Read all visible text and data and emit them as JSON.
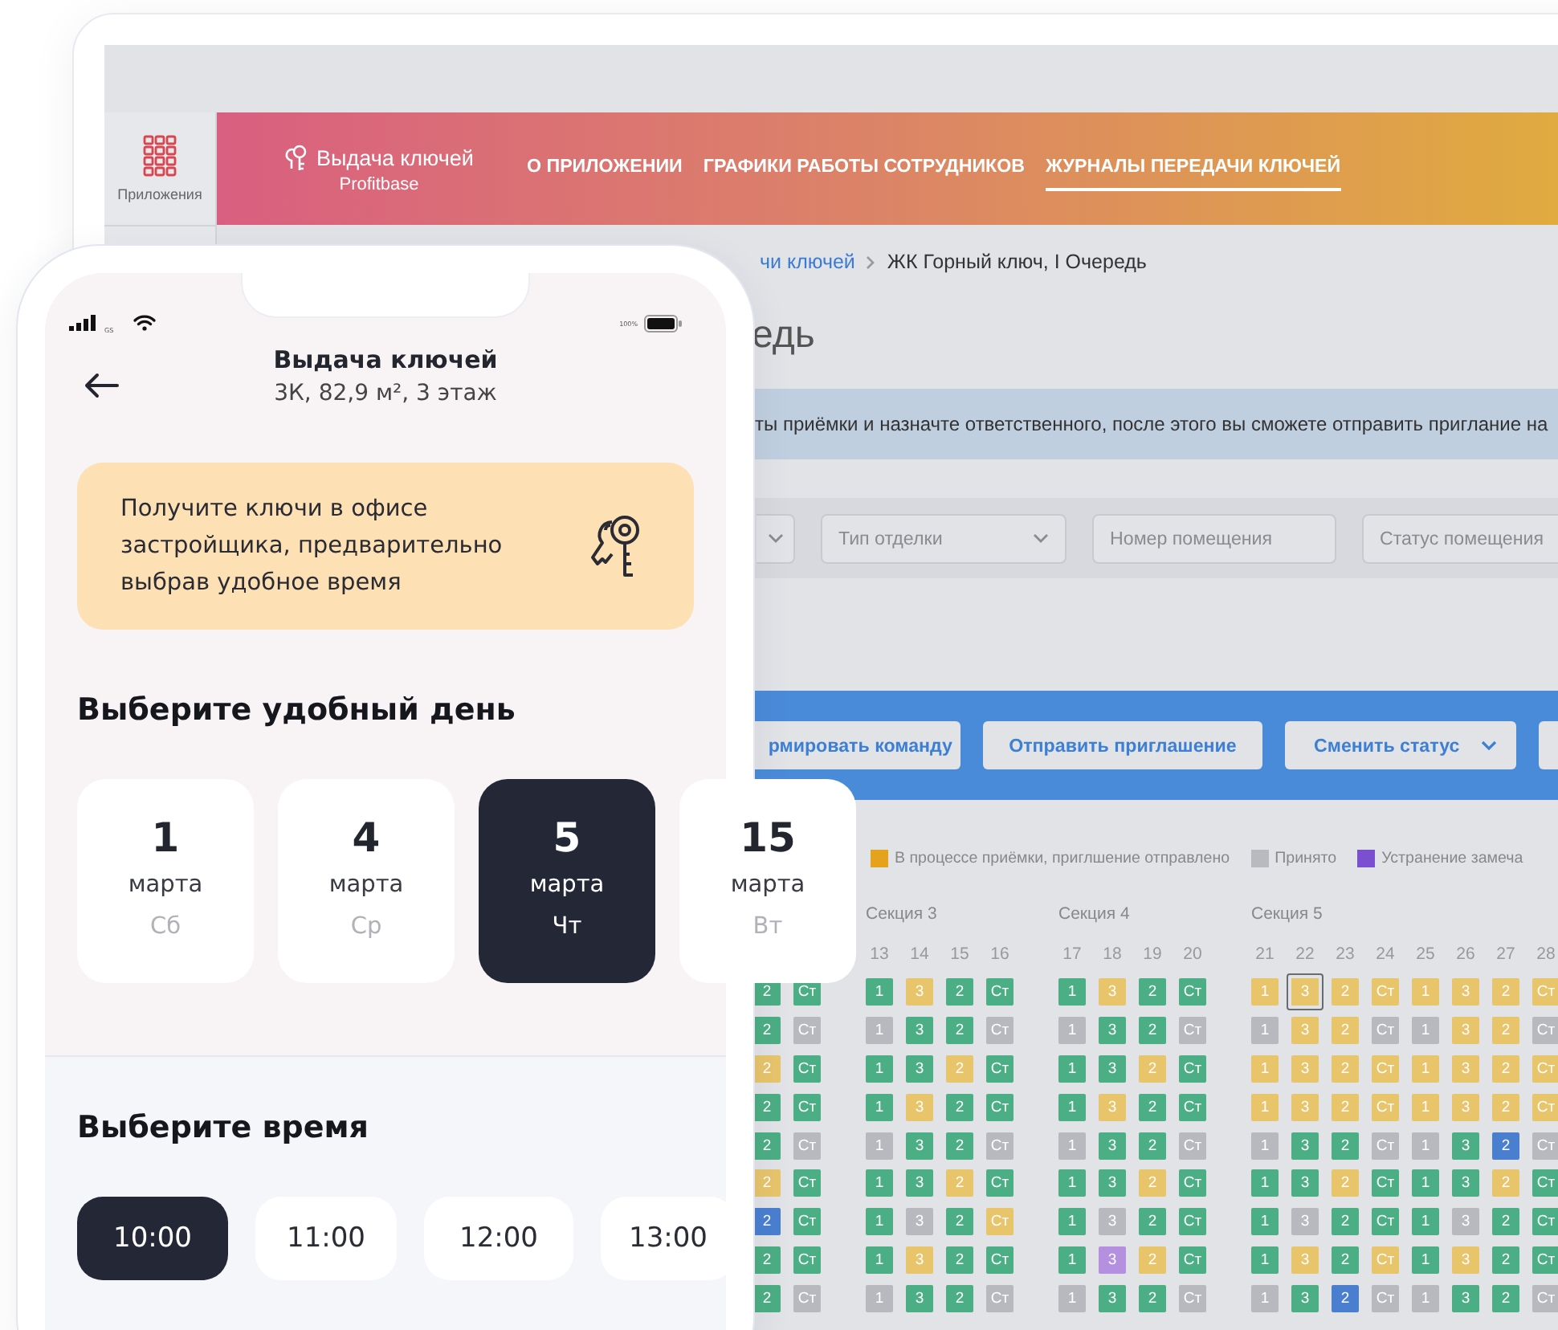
{
  "desktop": {
    "sidebar": {
      "apps_label": "Приложения"
    },
    "header": {
      "app_name": "Выдача ключей",
      "vendor": "Profitbase",
      "nav": [
        {
          "label": "О ПРИЛОЖЕНИИ",
          "selected": false
        },
        {
          "label": "ГРАФИКИ РАБОТЫ СОТРУДНИКОВ",
          "selected": false
        },
        {
          "label": "ЖУРНАЛЫ ПЕРЕДАЧИ КЛЮЧЕЙ",
          "selected": true
        }
      ]
    },
    "breadcrumbs": [
      {
        "label": "чи ключей",
        "kind": "link"
      },
      {
        "label": "ЖК Горный ключ, I Очередь",
        "kind": "current"
      }
    ],
    "page_title": "едь",
    "info_banner": "ты приёмки и назначте ответственного, после этого вы сможете отправить приглание на",
    "filters": [
      {
        "kind": "select"
      },
      {
        "kind": "select",
        "placeholder": "Тип отделки"
      },
      {
        "kind": "input",
        "placeholder": "Номер помещения"
      },
      {
        "kind": "input",
        "placeholder": "Статус помещения"
      }
    ],
    "actions": [
      {
        "label": "рмировать команду",
        "dropdown": false
      },
      {
        "label": "Отправить приглашение",
        "dropdown": false
      },
      {
        "label": "Сменить статус",
        "dropdown": true
      }
    ],
    "legend": [
      {
        "label": "В процессе приёмки, приглшение отправлено",
        "color": "#e5a21c"
      },
      {
        "label": "Принято",
        "color": "#b9babf"
      },
      {
        "label": "Устранение замеча",
        "color": "#7a4fd0"
      }
    ],
    "sections": [
      {
        "rows": [
          [
            {
              "label": "2",
              "color": "#4cae84",
              "selected": false
            },
            {
              "label": "Ст",
              "color": "#4cae84",
              "selected": false
            }
          ],
          [
            {
              "label": "2",
              "color": "#4cae84",
              "selected": false
            },
            {
              "label": "Ст",
              "color": "#b8b9be",
              "selected": false
            }
          ],
          [
            {
              "label": "2",
              "color": "#e8c46b",
              "selected": false
            },
            {
              "label": "Ст",
              "color": "#4cae84",
              "selected": false
            }
          ],
          [
            {
              "label": "2",
              "color": "#4cae84",
              "selected": false
            },
            {
              "label": "Ст",
              "color": "#4cae84",
              "selected": false
            }
          ],
          [
            {
              "label": "2",
              "color": "#4cae84",
              "selected": false
            },
            {
              "label": "Ст",
              "color": "#b8b9be",
              "selected": false
            }
          ],
          [
            {
              "label": "2",
              "color": "#e8c46b",
              "selected": false
            },
            {
              "label": "Ст",
              "color": "#4cae84",
              "selected": false
            }
          ],
          [
            {
              "label": "2",
              "color": "#4a7fd0",
              "selected": false
            },
            {
              "label": "Ст",
              "color": "#4cae84",
              "selected": false
            }
          ],
          [
            {
              "label": "2",
              "color": "#4cae84",
              "selected": false
            },
            {
              "label": "Ст",
              "color": "#4cae84",
              "selected": false
            }
          ],
          [
            {
              "label": "2",
              "color": "#4cae84",
              "selected": false
            },
            {
              "label": "Ст",
              "color": "#b8b9be",
              "selected": false
            }
          ]
        ]
      },
      {
        "title": "Секция 3",
        "columns": [
          "13",
          "14",
          "15",
          "16"
        ],
        "rows": [
          [
            {
              "label": "1",
              "color": "#4cae84",
              "selected": false
            },
            {
              "label": "3",
              "color": "#e8c46b",
              "selected": false
            },
            {
              "label": "2",
              "color": "#4cae84",
              "selected": false
            },
            {
              "label": "Ст",
              "color": "#4cae84",
              "selected": false
            }
          ],
          [
            {
              "label": "1",
              "color": "#b8b9be",
              "selected": false
            },
            {
              "label": "3",
              "color": "#4cae84",
              "selected": false
            },
            {
              "label": "2",
              "color": "#4cae84",
              "selected": false
            },
            {
              "label": "Ст",
              "color": "#b8b9be",
              "selected": false
            }
          ],
          [
            {
              "label": "1",
              "color": "#4cae84",
              "selected": false
            },
            {
              "label": "3",
              "color": "#4cae84",
              "selected": false
            },
            {
              "label": "2",
              "color": "#e8c46b",
              "selected": false
            },
            {
              "label": "Ст",
              "color": "#4cae84",
              "selected": false
            }
          ],
          [
            {
              "label": "1",
              "color": "#4cae84",
              "selected": false
            },
            {
              "label": "3",
              "color": "#e8c46b",
              "selected": false
            },
            {
              "label": "2",
              "color": "#4cae84",
              "selected": false
            },
            {
              "label": "Ст",
              "color": "#4cae84",
              "selected": false
            }
          ],
          [
            {
              "label": "1",
              "color": "#b8b9be",
              "selected": false
            },
            {
              "label": "3",
              "color": "#4cae84",
              "selected": false
            },
            {
              "label": "2",
              "color": "#4cae84",
              "selected": false
            },
            {
              "label": "Ст",
              "color": "#b8b9be",
              "selected": false
            }
          ],
          [
            {
              "label": "1",
              "color": "#4cae84",
              "selected": false
            },
            {
              "label": "3",
              "color": "#4cae84",
              "selected": false
            },
            {
              "label": "2",
              "color": "#e8c46b",
              "selected": false
            },
            {
              "label": "Ст",
              "color": "#4cae84",
              "selected": false
            }
          ],
          [
            {
              "label": "1",
              "color": "#4cae84",
              "selected": false
            },
            {
              "label": "3",
              "color": "#b8b9be",
              "selected": false
            },
            {
              "label": "2",
              "color": "#4cae84",
              "selected": false
            },
            {
              "label": "Ст",
              "color": "#e8c46b",
              "selected": false
            }
          ],
          [
            {
              "label": "1",
              "color": "#4cae84",
              "selected": false
            },
            {
              "label": "3",
              "color": "#e8c46b",
              "selected": false
            },
            {
              "label": "2",
              "color": "#4cae84",
              "selected": false
            },
            {
              "label": "Ст",
              "color": "#4cae84",
              "selected": false
            }
          ],
          [
            {
              "label": "1",
              "color": "#b8b9be",
              "selected": false
            },
            {
              "label": "3",
              "color": "#4cae84",
              "selected": false
            },
            {
              "label": "2",
              "color": "#4cae84",
              "selected": false
            },
            {
              "label": "Ст",
              "color": "#b8b9be",
              "selected": false
            }
          ]
        ]
      },
      {
        "title": "Секция 4",
        "columns": [
          "17",
          "18",
          "19",
          "20"
        ],
        "rows": [
          [
            {
              "label": "1",
              "color": "#4cae84",
              "selected": false
            },
            {
              "label": "3",
              "color": "#e8c46b",
              "selected": false
            },
            {
              "label": "2",
              "color": "#4cae84",
              "selected": false
            },
            {
              "label": "Ст",
              "color": "#4cae84",
              "selected": false
            }
          ],
          [
            {
              "label": "1",
              "color": "#b8b9be",
              "selected": false
            },
            {
              "label": "3",
              "color": "#4cae84",
              "selected": false
            },
            {
              "label": "2",
              "color": "#4cae84",
              "selected": false
            },
            {
              "label": "Ст",
              "color": "#b8b9be",
              "selected": false
            }
          ],
          [
            {
              "label": "1",
              "color": "#4cae84",
              "selected": false
            },
            {
              "label": "3",
              "color": "#4cae84",
              "selected": false
            },
            {
              "label": "2",
              "color": "#e8c46b",
              "selected": false
            },
            {
              "label": "Ст",
              "color": "#4cae84",
              "selected": false
            }
          ],
          [
            {
              "label": "1",
              "color": "#4cae84",
              "selected": false
            },
            {
              "label": "3",
              "color": "#e8c46b",
              "selected": false
            },
            {
              "label": "2",
              "color": "#4cae84",
              "selected": false
            },
            {
              "label": "Ст",
              "color": "#4cae84",
              "selected": false
            }
          ],
          [
            {
              "label": "1",
              "color": "#b8b9be",
              "selected": false
            },
            {
              "label": "3",
              "color": "#4cae84",
              "selected": false
            },
            {
              "label": "2",
              "color": "#4cae84",
              "selected": false
            },
            {
              "label": "Ст",
              "color": "#b8b9be",
              "selected": false
            }
          ],
          [
            {
              "label": "1",
              "color": "#4cae84",
              "selected": false
            },
            {
              "label": "3",
              "color": "#4cae84",
              "selected": false
            },
            {
              "label": "2",
              "color": "#e8c46b",
              "selected": false
            },
            {
              "label": "Ст",
              "color": "#4cae84",
              "selected": false
            }
          ],
          [
            {
              "label": "1",
              "color": "#4cae84",
              "selected": false
            },
            {
              "label": "3",
              "color": "#b8b9be",
              "selected": false
            },
            {
              "label": "2",
              "color": "#4cae84",
              "selected": false
            },
            {
              "label": "Ст",
              "color": "#4cae84",
              "selected": false
            }
          ],
          [
            {
              "label": "1",
              "color": "#4cae84",
              "selected": false
            },
            {
              "label": "3",
              "color": "#b58fe0",
              "selected": false
            },
            {
              "label": "2",
              "color": "#e8c46b",
              "selected": false
            },
            {
              "label": "Ст",
              "color": "#4cae84",
              "selected": false
            }
          ],
          [
            {
              "label": "1",
              "color": "#b8b9be",
              "selected": false
            },
            {
              "label": "3",
              "color": "#4cae84",
              "selected": false
            },
            {
              "label": "2",
              "color": "#4cae84",
              "selected": false
            },
            {
              "label": "Ст",
              "color": "#b8b9be",
              "selected": false
            }
          ]
        ]
      },
      {
        "title": "Секция 5",
        "columns": [
          "21",
          "22",
          "23",
          "24",
          "25",
          "26",
          "27",
          "28"
        ],
        "rows": [
          [
            {
              "label": "1",
              "color": "#e8c46b",
              "selected": false
            },
            {
              "label": "3",
              "color": "#e8c46b",
              "selected": true
            },
            {
              "label": "2",
              "color": "#e8c46b",
              "selected": false
            },
            {
              "label": "Ст",
              "color": "#e8c46b",
              "selected": false
            },
            {
              "label": "1",
              "color": "#e8c46b",
              "selected": false
            },
            {
              "label": "3",
              "color": "#e8c46b",
              "selected": false
            },
            {
              "label": "2",
              "color": "#e8c46b",
              "selected": false
            },
            {
              "label": "Ст",
              "color": "#e8c46b",
              "selected": false
            }
          ],
          [
            {
              "label": "1",
              "color": "#b8b9be",
              "selected": false
            },
            {
              "label": "3",
              "color": "#e8c46b",
              "selected": false
            },
            {
              "label": "2",
              "color": "#e8c46b",
              "selected": false
            },
            {
              "label": "Ст",
              "color": "#b8b9be",
              "selected": false
            },
            {
              "label": "1",
              "color": "#b8b9be",
              "selected": false
            },
            {
              "label": "3",
              "color": "#e8c46b",
              "selected": false
            },
            {
              "label": "2",
              "color": "#e8c46b",
              "selected": false
            },
            {
              "label": "Ст",
              "color": "#b8b9be",
              "selected": false
            }
          ],
          [
            {
              "label": "1",
              "color": "#e8c46b",
              "selected": false
            },
            {
              "label": "3",
              "color": "#e8c46b",
              "selected": false
            },
            {
              "label": "2",
              "color": "#e8c46b",
              "selected": false
            },
            {
              "label": "Ст",
              "color": "#e8c46b",
              "selected": false
            },
            {
              "label": "1",
              "color": "#e8c46b",
              "selected": false
            },
            {
              "label": "3",
              "color": "#e8c46b",
              "selected": false
            },
            {
              "label": "2",
              "color": "#e8c46b",
              "selected": false
            },
            {
              "label": "Ст",
              "color": "#e8c46b",
              "selected": false
            }
          ],
          [
            {
              "label": "1",
              "color": "#e8c46b",
              "selected": false
            },
            {
              "label": "3",
              "color": "#e8c46b",
              "selected": false
            },
            {
              "label": "2",
              "color": "#e8c46b",
              "selected": false
            },
            {
              "label": "Ст",
              "color": "#e8c46b",
              "selected": false
            },
            {
              "label": "1",
              "color": "#e8c46b",
              "selected": false
            },
            {
              "label": "3",
              "color": "#e8c46b",
              "selected": false
            },
            {
              "label": "2",
              "color": "#e8c46b",
              "selected": false
            },
            {
              "label": "Ст",
              "color": "#e8c46b",
              "selected": false
            }
          ],
          [
            {
              "label": "1",
              "color": "#b8b9be",
              "selected": false
            },
            {
              "label": "3",
              "color": "#4cae84",
              "selected": false
            },
            {
              "label": "2",
              "color": "#4cae84",
              "selected": false
            },
            {
              "label": "Ст",
              "color": "#b8b9be",
              "selected": false
            },
            {
              "label": "1",
              "color": "#b8b9be",
              "selected": false
            },
            {
              "label": "3",
              "color": "#4cae84",
              "selected": false
            },
            {
              "label": "2",
              "color": "#4a7fd0",
              "selected": false
            },
            {
              "label": "Ст",
              "color": "#b8b9be",
              "selected": false
            }
          ],
          [
            {
              "label": "1",
              "color": "#4cae84",
              "selected": false
            },
            {
              "label": "3",
              "color": "#4cae84",
              "selected": false
            },
            {
              "label": "2",
              "color": "#e8c46b",
              "selected": false
            },
            {
              "label": "Ст",
              "color": "#4cae84",
              "selected": false
            },
            {
              "label": "1",
              "color": "#4cae84",
              "selected": false
            },
            {
              "label": "3",
              "color": "#4cae84",
              "selected": false
            },
            {
              "label": "2",
              "color": "#e8c46b",
              "selected": false
            },
            {
              "label": "Ст",
              "color": "#4cae84",
              "selected": false
            }
          ],
          [
            {
              "label": "1",
              "color": "#4cae84",
              "selected": false
            },
            {
              "label": "3",
              "color": "#b8b9be",
              "selected": false
            },
            {
              "label": "2",
              "color": "#4cae84",
              "selected": false
            },
            {
              "label": "Ст",
              "color": "#4cae84",
              "selected": false
            },
            {
              "label": "1",
              "color": "#4cae84",
              "selected": false
            },
            {
              "label": "3",
              "color": "#b8b9be",
              "selected": false
            },
            {
              "label": "2",
              "color": "#4cae84",
              "selected": false
            },
            {
              "label": "Ст",
              "color": "#4cae84",
              "selected": false
            }
          ],
          [
            {
              "label": "1",
              "color": "#4cae84",
              "selected": false
            },
            {
              "label": "3",
              "color": "#e8c46b",
              "selected": false
            },
            {
              "label": "2",
              "color": "#4cae84",
              "selected": false
            },
            {
              "label": "Ст",
              "color": "#e8c46b",
              "selected": false
            },
            {
              "label": "1",
              "color": "#4cae84",
              "selected": false
            },
            {
              "label": "3",
              "color": "#e8c46b",
              "selected": false
            },
            {
              "label": "2",
              "color": "#4cae84",
              "selected": false
            },
            {
              "label": "Ст",
              "color": "#4cae84",
              "selected": false
            }
          ],
          [
            {
              "label": "1",
              "color": "#b8b9be",
              "selected": false
            },
            {
              "label": "3",
              "color": "#4cae84",
              "selected": false
            },
            {
              "label": "2",
              "color": "#4a7fd0",
              "selected": false
            },
            {
              "label": "Ст",
              "color": "#b8b9be",
              "selected": false
            },
            {
              "label": "1",
              "color": "#b8b9be",
              "selected": false
            },
            {
              "label": "3",
              "color": "#4cae84",
              "selected": false
            },
            {
              "label": "2",
              "color": "#4cae84",
              "selected": false
            },
            {
              "label": "Ст",
              "color": "#b8b9be",
              "selected": false
            }
          ]
        ]
      }
    ]
  },
  "phone": {
    "status_bar": {
      "network": "GS",
      "battery": "100%"
    },
    "title": "Выдача ключей",
    "subtitle": "3К, 82,9 м², 3 этаж",
    "notice": "Получите ключи в офисе застройщика, предварительно выбрав удобное время",
    "day_heading": "Выберите удобный день",
    "days": [
      {
        "day": "1",
        "month": "марта",
        "weekday": "Сб",
        "selected": false
      },
      {
        "day": "4",
        "month": "марта",
        "weekday": "Ср",
        "selected": false
      },
      {
        "day": "5",
        "month": "марта",
        "weekday": "Чт",
        "selected": true
      },
      {
        "day": "15",
        "month": "марта",
        "weekday": "Вт",
        "selected": false
      }
    ],
    "time_heading": "Выберите время",
    "times": [
      {
        "label": "10:00",
        "selected": true
      },
      {
        "label": "11:00",
        "selected": false
      },
      {
        "label": "12:00",
        "selected": false
      },
      {
        "label": "13:00",
        "selected": false
      }
    ]
  }
}
